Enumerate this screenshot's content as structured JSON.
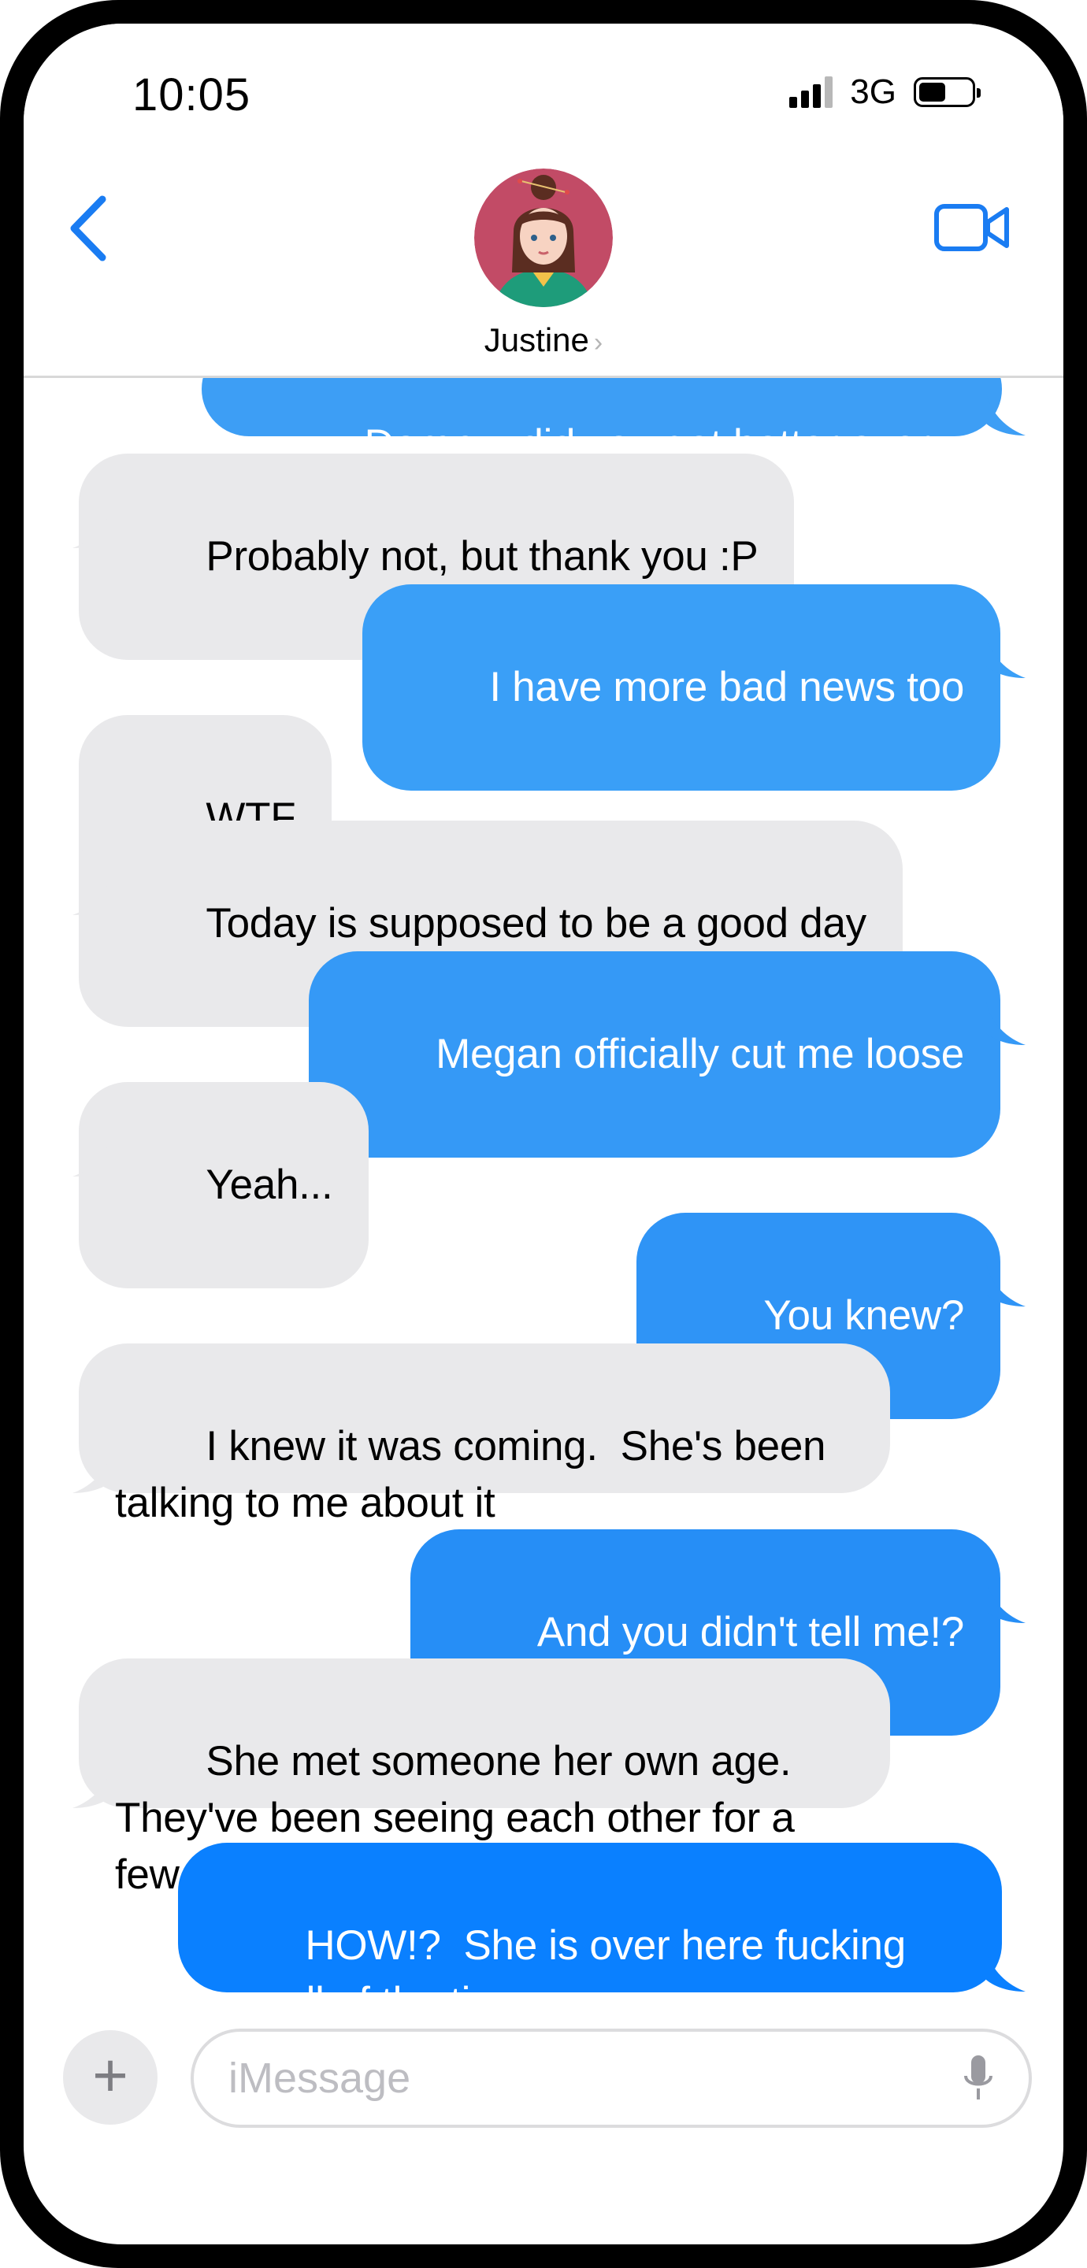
{
  "status_bar": {
    "time": "10:05",
    "network": "3G",
    "battery_percent": 52
  },
  "header": {
    "contact_name": "Justine",
    "chevron": "›"
  },
  "messages": [
    {
      "from": "me",
      "text": "Damn... did you get hotter over night?",
      "partial": true
    },
    {
      "from": "them",
      "text": "Probably not, but thank you :P"
    },
    {
      "from": "me",
      "text": "I have more bad news too"
    },
    {
      "from": "them",
      "text": "WTF"
    },
    {
      "from": "them",
      "text": "Today is supposed to be a good day"
    },
    {
      "from": "me",
      "text": "Megan officially cut me loose"
    },
    {
      "from": "them",
      "text": "Yeah..."
    },
    {
      "from": "me",
      "text": "You knew?"
    },
    {
      "from": "them",
      "text": "I knew it was coming.  She's been talking to me about it"
    },
    {
      "from": "me",
      "text": "And you didn't tell me!?"
    },
    {
      "from": "them",
      "text": "She met someone her own age.  They've been seeing each other for a few weeks"
    },
    {
      "from": "me",
      "text": "HOW!?  She is over here fucking me all of the time"
    }
  ],
  "input": {
    "placeholder": "iMessage",
    "plus_label": "+"
  },
  "colors": {
    "blue_light": "#3a9ff7",
    "blue_dark": "#0a84ff",
    "gray_bubble": "#e9e9eb",
    "ios_blue": "#1a7cf2"
  },
  "icons": [
    "back-chevron-icon",
    "video-camera-icon",
    "plus-icon",
    "microphone-icon",
    "signal-icon",
    "battery-icon"
  ]
}
